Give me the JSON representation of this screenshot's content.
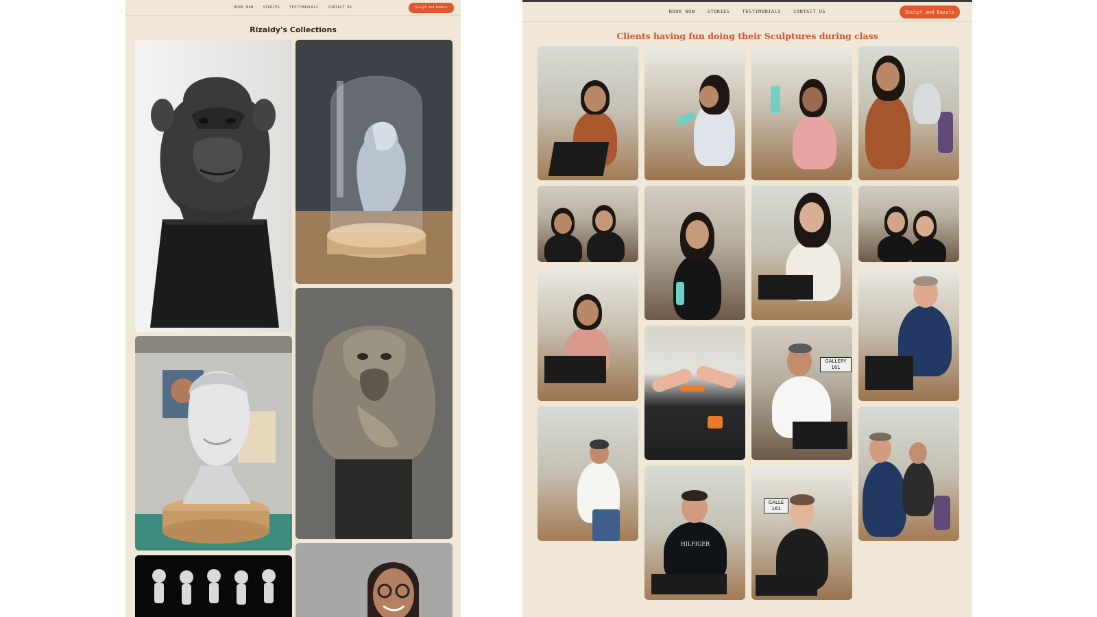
{
  "left_page": {
    "nav": [
      "BOOK NOW",
      "STORIES",
      "TESTIMONIALS",
      "CONTACT US"
    ],
    "cta_label": "Sculpt and Dazzle",
    "title": "Rizaldy's Collections"
  },
  "right_page": {
    "nav": [
      "BOOK NOW",
      "STORIES",
      "TESTIMONIALS",
      "CONTACT US"
    ],
    "cta_label": "Sculpt and Dazzle",
    "title": "Clients having fun doing their Sculptures during class",
    "photo_labels": {
      "gallery_sign": "GALLERY 161",
      "gallery_sign_2": "GALLE 161",
      "shirt_text": "HILFIGER"
    }
  },
  "colors": {
    "page_bg": "#f0e7d6",
    "accent": "#e2572c",
    "title_accent": "#d8502a"
  }
}
